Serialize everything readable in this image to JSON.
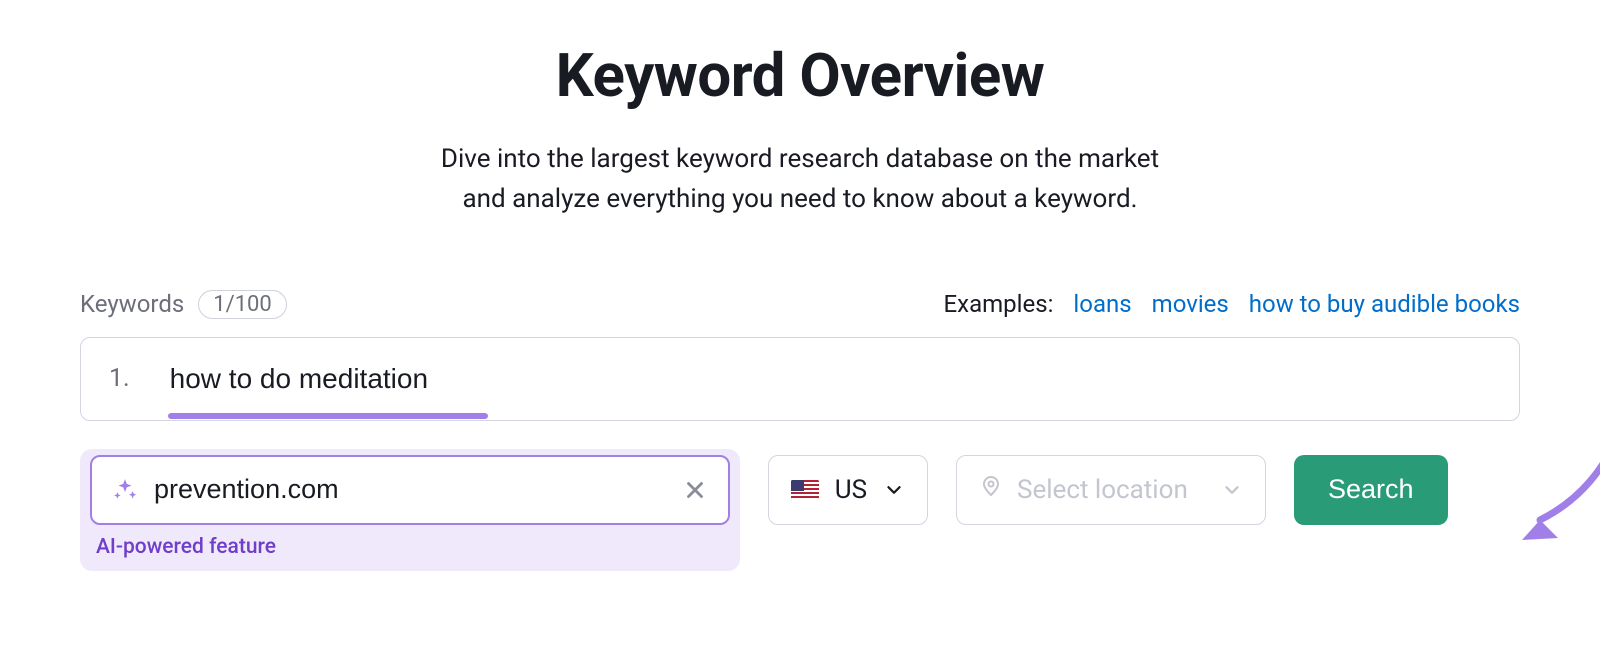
{
  "title": "Keyword Overview",
  "subtitle_line1": "Dive into the largest keyword research database on the market",
  "subtitle_line2": "and analyze everything you need to know about a keyword.",
  "keywords_label": "Keywords",
  "keywords_count": "1/100",
  "examples_label": "Examples:",
  "examples": {
    "e0": "loans",
    "e1": "movies",
    "e2": "how to buy audible books"
  },
  "keyword_entry": {
    "num": "1.",
    "text": "how to do meditation"
  },
  "domain_input": {
    "value": "prevention.com"
  },
  "ai_caption": "AI-powered feature",
  "country": {
    "label": "US"
  },
  "location": {
    "placeholder": "Select location"
  },
  "search_label": "Search"
}
